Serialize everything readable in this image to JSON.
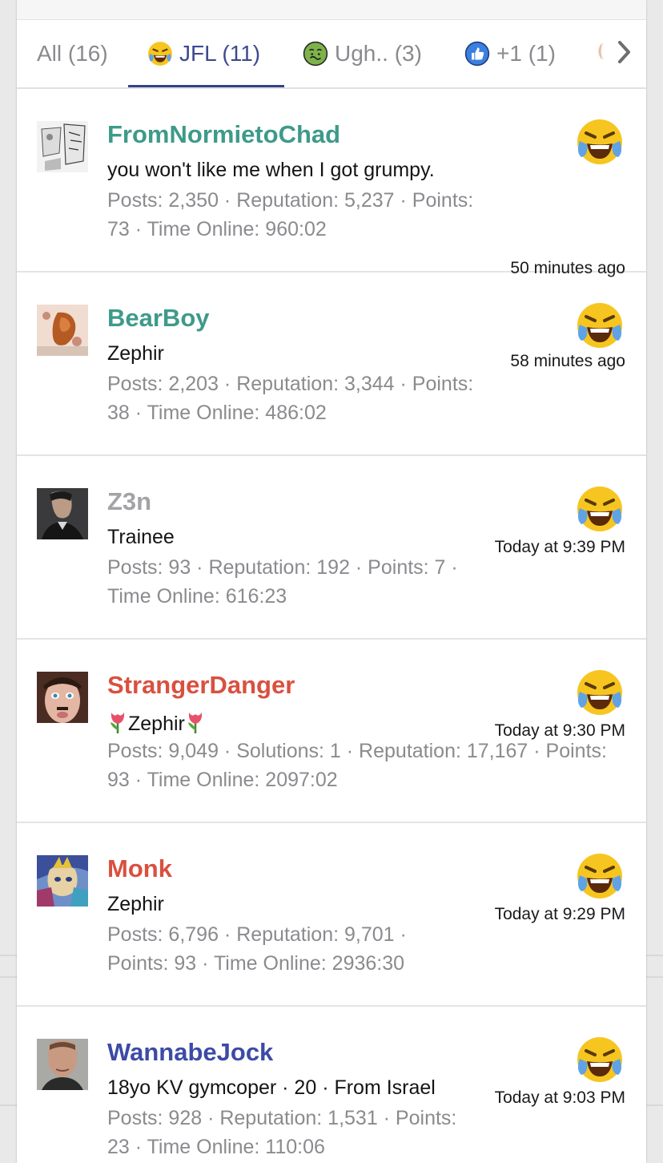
{
  "tabs": [
    {
      "label": "All (16)",
      "icon": ""
    },
    {
      "label": "JFL (11)",
      "icon": "laughing-crying-emoji"
    },
    {
      "label": "Ugh.. (3)",
      "icon": "nauseated-emoji"
    },
    {
      "label": "+1 (1)",
      "icon": "thumbs-up-emoji"
    }
  ],
  "active_tab": "JFL (11)",
  "colors": {
    "teal_name": "#3e9a8a",
    "gray_name": "#a3a3a7",
    "red_name": "#d9503f",
    "blue_name": "#3d4ba6",
    "tab_active": "#3d4a8f"
  },
  "reactions": [
    {
      "username": "FromNormietoChad",
      "name_color": "#3e9a8a",
      "title": "you won't like me when I got grumpy.",
      "stats": "Posts: 2,350 · Reputation: 5,237 · Points: 73 · Time Online: 960:02",
      "reaction_icon": "laughing-crying-emoji",
      "time": "50 minutes ago"
    },
    {
      "username": "BearBoy",
      "name_color": "#3e9a8a",
      "title": "Zephir",
      "stats": "Posts: 2,203 · Reputation: 3,344 · Points: 38 · Time Online: 486:02",
      "reaction_icon": "laughing-crying-emoji",
      "time": "58 minutes ago"
    },
    {
      "username": "Z3n",
      "name_color": "#a3a3a7",
      "title": "Trainee",
      "stats": "Posts: 93 · Reputation: 192 · Points: 7 · Time Online: 616:23",
      "reaction_icon": "laughing-crying-emoji",
      "time": "Today at 9:39 PM"
    },
    {
      "username": "StrangerDanger",
      "name_color": "#d9503f",
      "title": "Zephir",
      "title_decoration": "tulip-emoji",
      "stats": "Posts: 9,049 · Solutions: 1 · Reputation: 17,167 · Points: 93 · Time Online: 2097:02",
      "reaction_icon": "laughing-crying-emoji",
      "time": "Today at 9:30 PM"
    },
    {
      "username": "Monk",
      "name_color": "#d9503f",
      "title": "Zephir",
      "stats": "Posts: 6,796 · Reputation: 9,701 · Points: 93 · Time Online: 2936:30",
      "reaction_icon": "laughing-crying-emoji",
      "time": "Today at 9:29 PM"
    },
    {
      "username": "WannabeJock",
      "name_color": "#3d4ba6",
      "title": "18yo KV gymcoper · 20 · From Israel",
      "stats": "Posts: 928 · Reputation: 1,531 · Points: 23 · Time Online: 110:06",
      "reaction_icon": "laughing-crying-emoji",
      "time": "Today at 9:03 PM"
    }
  ]
}
